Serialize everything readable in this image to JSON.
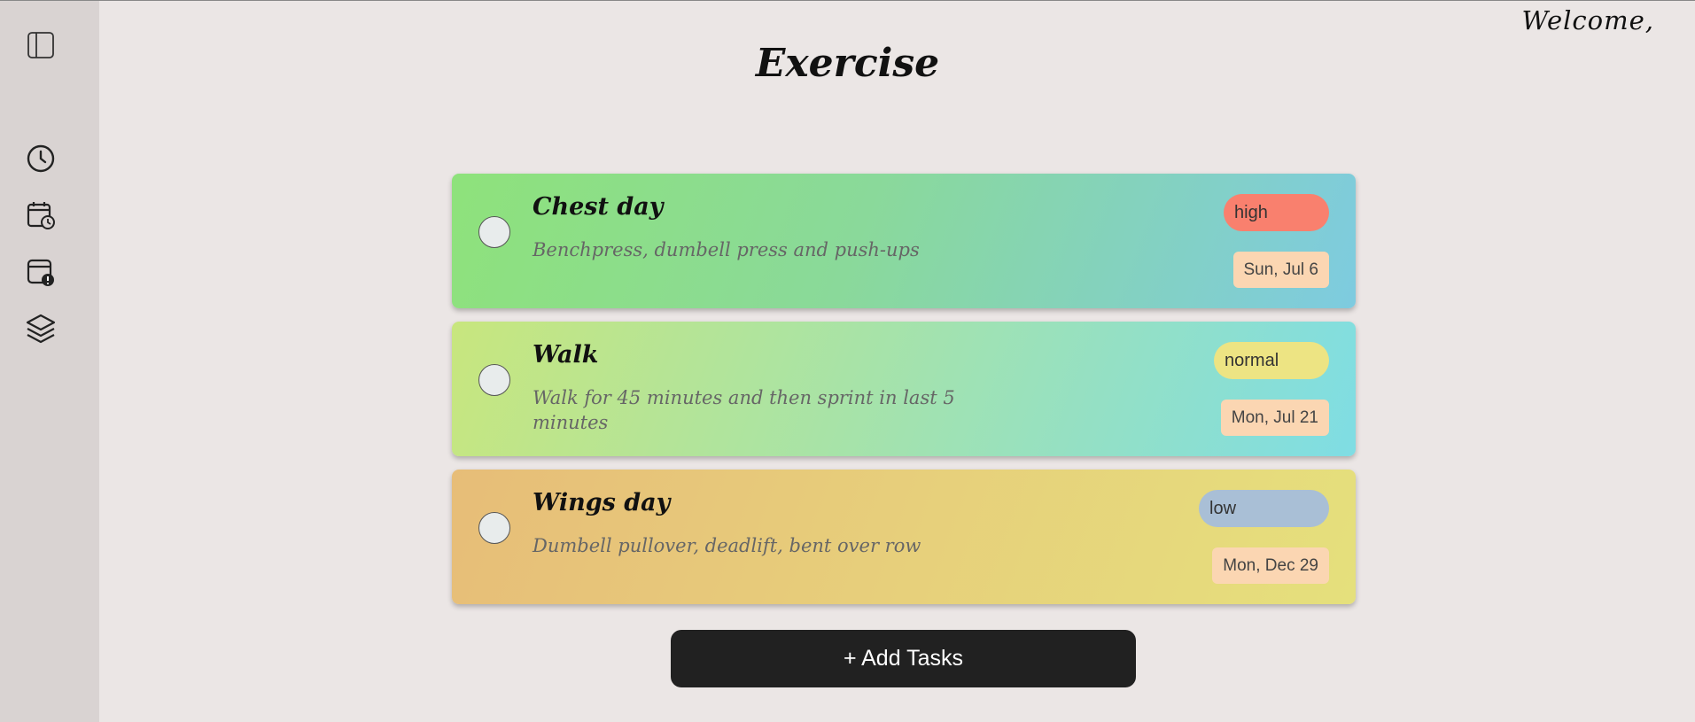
{
  "header": {
    "welcome": "Welcome,",
    "page_title": "Exercise"
  },
  "sidebar": {
    "items": [
      {
        "icon": "sidebar-toggle-icon"
      },
      {
        "icon": "clock-icon"
      },
      {
        "icon": "calendar-clock-icon"
      },
      {
        "icon": "calendar-alert-icon"
      },
      {
        "icon": "layers-icon"
      }
    ]
  },
  "tasks": [
    {
      "title": "Chest day",
      "description": "Benchpress, dumbell press and push-ups",
      "priority": "high",
      "priority_color": "#f9806e",
      "due": "Sun, Jul 6"
    },
    {
      "title": "Walk",
      "description": "Walk for 45 minutes and then sprint in last 5 minutes",
      "priority": "normal",
      "priority_color": "#ede483",
      "due": "Mon, Jul 21"
    },
    {
      "title": "Wings day",
      "description": "Dumbell pullover, deadlift, bent over row",
      "priority": "low",
      "priority_color": "#a9bfd6",
      "due": "Mon, Dec 29"
    }
  ],
  "actions": {
    "add_tasks_label": "+ Add Tasks"
  }
}
